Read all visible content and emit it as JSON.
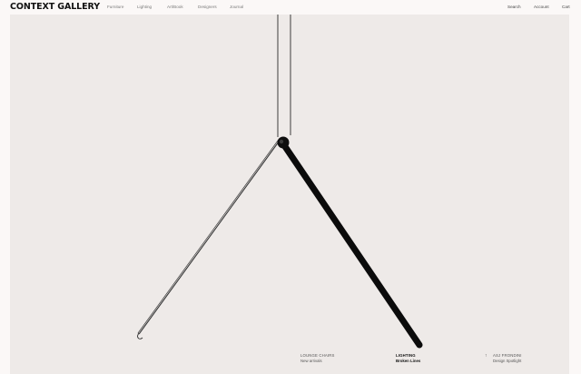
{
  "brand": "CONTEXT GALLERY",
  "nav": {
    "left": [
      "Furniture",
      "Lighting",
      "Art/Book",
      "Designers",
      "Journal"
    ],
    "right": [
      "Search",
      "Account",
      "Cart"
    ]
  },
  "hero": {
    "slides": [
      {
        "category": "LOUNGE CHAIRS",
        "subtitle": "New arrivals"
      },
      {
        "category": "LIGHTING",
        "subtitle": "Broken Lines"
      },
      {
        "category": "ASJ FRONDINI",
        "subtitle": "Design Spotlight"
      }
    ],
    "active_index": 1,
    "arrow_icon": "arrow-up-icon",
    "arrow_glyph": "↑"
  }
}
